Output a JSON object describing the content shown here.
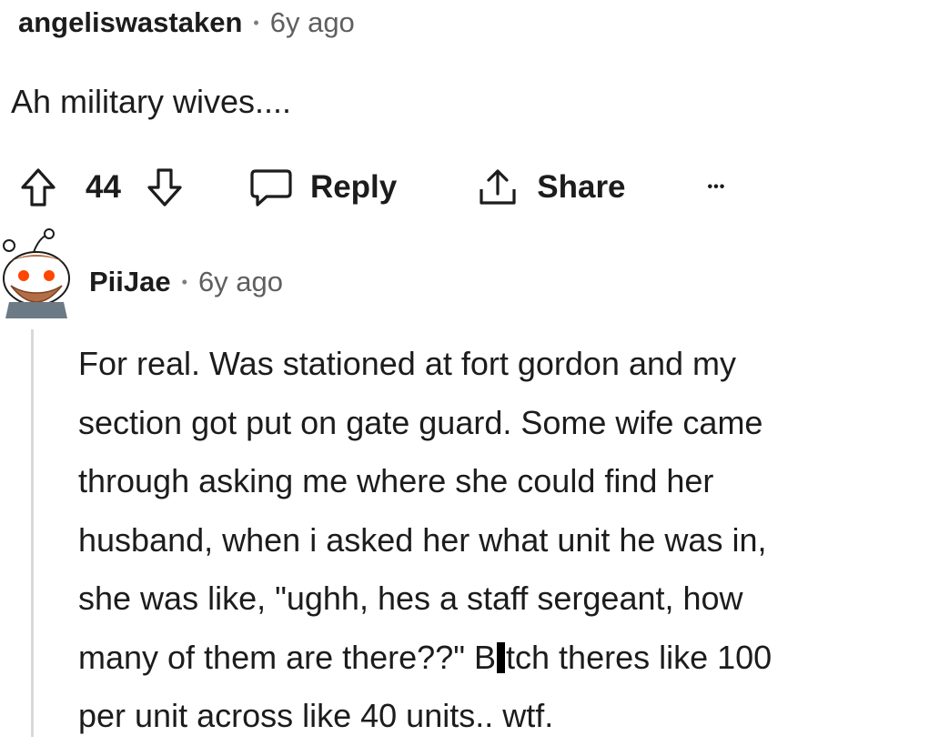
{
  "comment1": {
    "username": "angeliswastaken",
    "separator": "•",
    "age": "6y ago",
    "body": "Ah military wives...."
  },
  "actions": {
    "upvote_icon": "upvote-arrow-icon",
    "score": "44",
    "downvote_icon": "downvote-arrow-icon",
    "reply_icon": "speech-bubble-icon",
    "reply_label": "Reply",
    "share_icon": "share-upload-icon",
    "share_label": "Share",
    "more_label": "•••"
  },
  "comment2": {
    "avatar_icon": "reddit-snoo-avatar-bearded-icon",
    "username": "PiiJae",
    "separator": "•",
    "age": "6y ago",
    "lines": [
      "For real. Was stationed at fort gordon and my",
      "section got put on gate guard. Some wife came",
      "through asking me where she could find her",
      "husband, when i asked her what unit he was in,",
      "she was like, \"ughh, hes a staff sergeant, how"
    ],
    "line6_before": "many of them are there??\" B",
    "line6_after": "tch theres like 100",
    "line7": "per unit across like 40 units.. wtf."
  },
  "colors": {
    "text": "#1c1c1c",
    "meta": "#5f5f5f",
    "thread_line": "#d7d9dc",
    "censor_bar": "#000000"
  }
}
